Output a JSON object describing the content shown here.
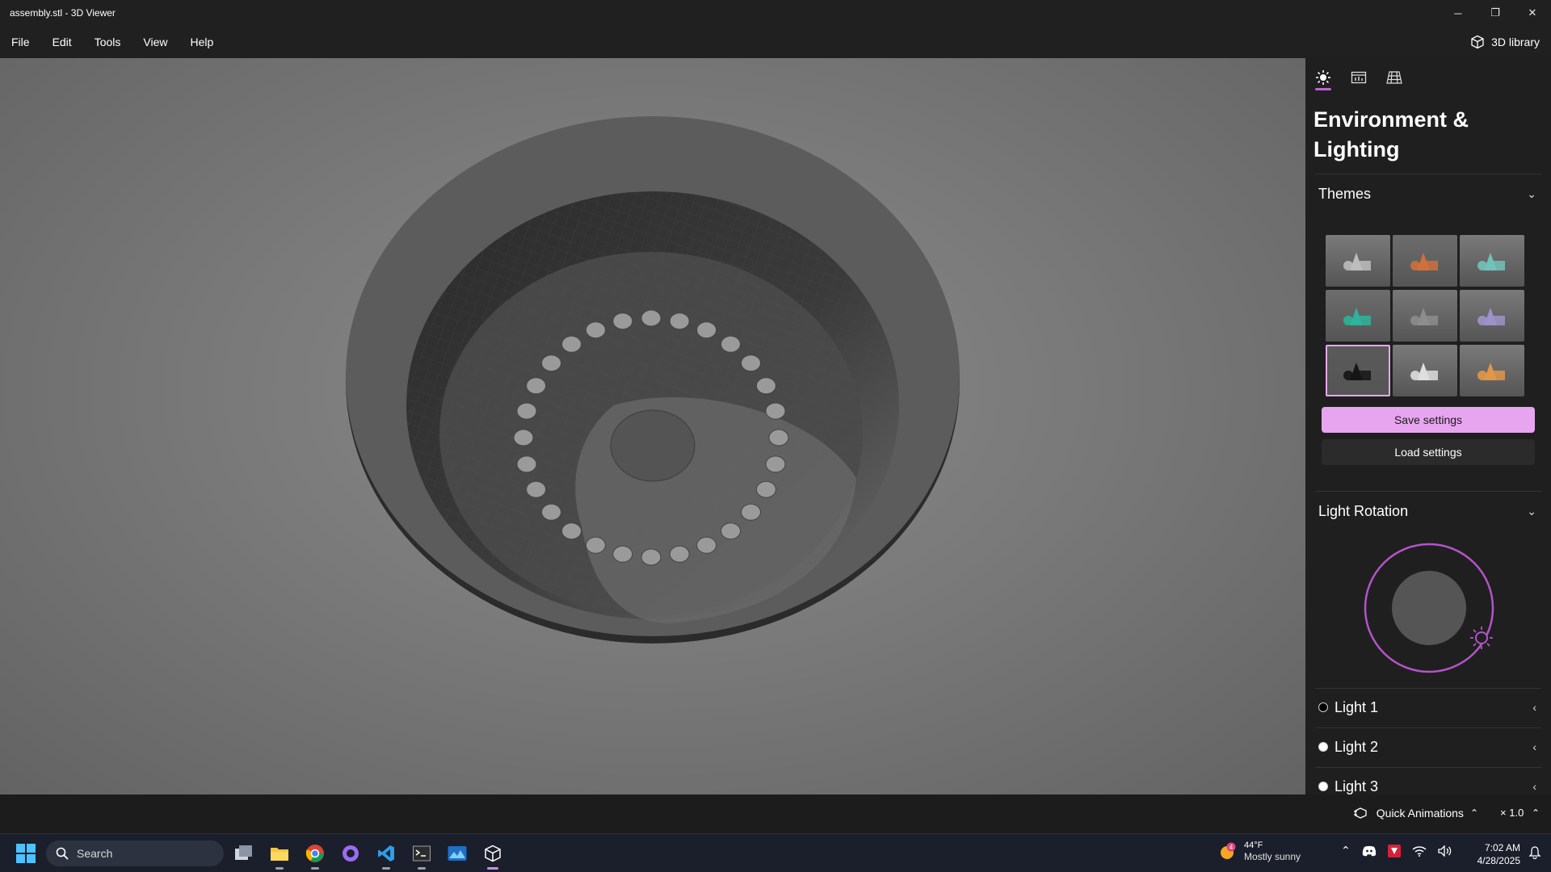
{
  "window": {
    "title": "assembly.stl - 3D Viewer",
    "controls": {
      "minimize": "─",
      "restore": "❐",
      "close": "✕"
    }
  },
  "menu": {
    "items": [
      "File",
      "Edit",
      "Tools",
      "View",
      "Help"
    ],
    "library_label": "3D library",
    "library_icon": "cube-icon"
  },
  "panel": {
    "tabs": [
      {
        "icon": "sun-icon",
        "active": true
      },
      {
        "icon": "stats-icon",
        "active": false
      },
      {
        "icon": "grid-icon",
        "active": false
      }
    ],
    "title": "Environment & Lighting",
    "themes": {
      "heading": "Themes",
      "selected_index": 6,
      "tiles": [
        {
          "bg": "#7a7a7a",
          "shape_color": "#bdbdbd"
        },
        {
          "bg": "#6d6d6d",
          "shape_color": "#d0703a"
        },
        {
          "bg": "#7a7a7a",
          "shape_color": "#72c2bb"
        },
        {
          "bg": "#6d6d6d",
          "shape_color": "#2fb39a"
        },
        {
          "bg": "#777777",
          "shape_color": "#8d8d8d"
        },
        {
          "bg": "#7a7a7a",
          "shape_color": "#9e93c8"
        },
        {
          "bg": "#5a5a5a",
          "shape_color": "#151515"
        },
        {
          "bg": "#7a7a7a",
          "shape_color": "#dedede"
        },
        {
          "bg": "#7a7a7a",
          "shape_color": "#e09748"
        }
      ]
    },
    "save_label": "Save settings",
    "load_label": "Load settings",
    "rotation": {
      "heading": "Light Rotation",
      "accent": "#b354c9"
    },
    "lights": [
      {
        "label": "Light 1",
        "dot": "#000000"
      },
      {
        "label": "Light 2",
        "dot": "#ffffff"
      },
      {
        "label": "Light 3",
        "dot": "#ffffff"
      }
    ]
  },
  "status": {
    "animations_label": "Quick Animations",
    "speed_label": "× 1.0"
  },
  "taskbar": {
    "search_placeholder": "Search",
    "apps": [
      "task-view-icon",
      "file-explorer-icon",
      "chrome-icon",
      "github-icon",
      "vscode-icon",
      "terminal-icon",
      "photos-icon",
      "3d-viewer-icon"
    ],
    "weather": {
      "badge": "4",
      "temp": "44°F",
      "condition": "Mostly sunny"
    },
    "clock": {
      "time": "7:02 AM",
      "date": "4/28/2025"
    }
  }
}
